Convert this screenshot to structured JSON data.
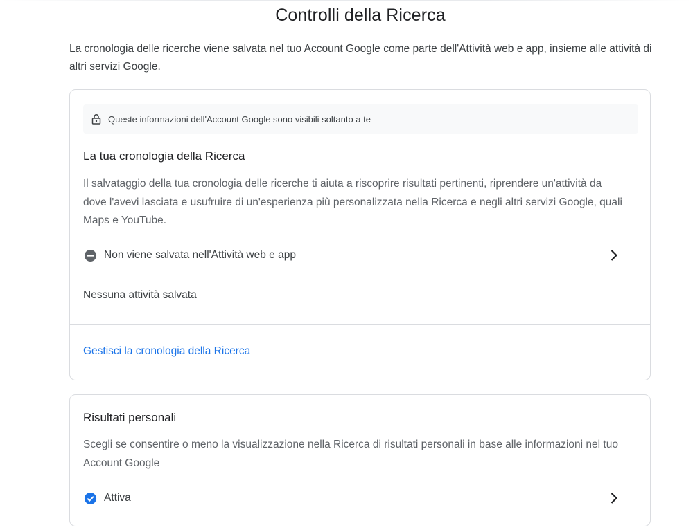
{
  "page": {
    "title": "Controlli della Ricerca",
    "intro": "La cronologia delle ricerche viene salvata nel tuo Account Google come parte dell'Attività web e app, insieme alle attività di altri servizi Google."
  },
  "history_card": {
    "privacy_notice": "Queste informazioni dell'Account Google sono visibili soltanto a te",
    "privacy_icon": "lock-icon",
    "title": "La tua cronologia della Ricerca",
    "description": "Il salvataggio della tua cronologia delle ricerche ti aiuta a riscoprire risultati pertinenti, riprendere un'attività da dove l'avevi lasciata e usufruire di un'esperienza più personalizzata nella Ricerca e negli altri servizi Google, quali Maps e YouTube.",
    "status_label": "Non viene salvata nell'Attività web e app",
    "status_icon": "minus-circle-icon",
    "empty_text": "Nessuna attività salvata",
    "manage_link": "Gestisci la cronologia della Ricerca"
  },
  "personal_results_card": {
    "title": "Risultati personali",
    "description": "Scegli se consentire o meno la visualizzazione nella Ricerca di risultati personali in base alle informazioni nel tuo Account Google",
    "status_label": "Attiva",
    "status_icon": "check-circle-icon"
  },
  "colors": {
    "link": "#1a73e8",
    "check": "#1a73e8",
    "blocked": "#5f6368",
    "border": "#dadce0"
  }
}
